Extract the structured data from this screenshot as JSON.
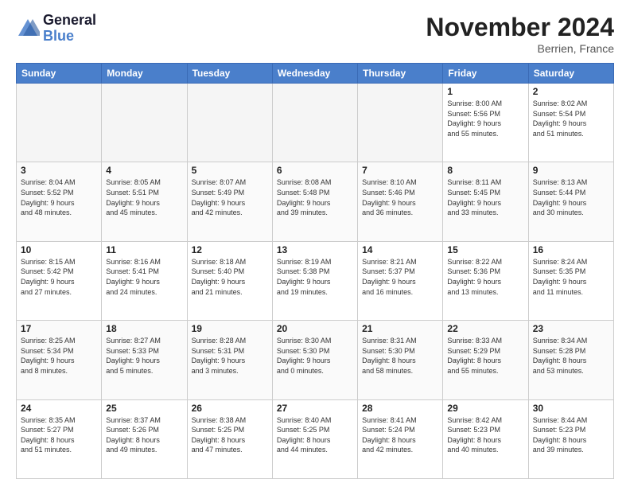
{
  "logo": {
    "line1": "General",
    "line2": "Blue"
  },
  "title": "November 2024",
  "location": "Berrien, France",
  "days_of_week": [
    "Sunday",
    "Monday",
    "Tuesday",
    "Wednesday",
    "Thursday",
    "Friday",
    "Saturday"
  ],
  "weeks": [
    [
      {
        "day": "",
        "info": ""
      },
      {
        "day": "",
        "info": ""
      },
      {
        "day": "",
        "info": ""
      },
      {
        "day": "",
        "info": ""
      },
      {
        "day": "",
        "info": ""
      },
      {
        "day": "1",
        "info": "Sunrise: 8:00 AM\nSunset: 5:56 PM\nDaylight: 9 hours\nand 55 minutes."
      },
      {
        "day": "2",
        "info": "Sunrise: 8:02 AM\nSunset: 5:54 PM\nDaylight: 9 hours\nand 51 minutes."
      }
    ],
    [
      {
        "day": "3",
        "info": "Sunrise: 8:04 AM\nSunset: 5:52 PM\nDaylight: 9 hours\nand 48 minutes."
      },
      {
        "day": "4",
        "info": "Sunrise: 8:05 AM\nSunset: 5:51 PM\nDaylight: 9 hours\nand 45 minutes."
      },
      {
        "day": "5",
        "info": "Sunrise: 8:07 AM\nSunset: 5:49 PM\nDaylight: 9 hours\nand 42 minutes."
      },
      {
        "day": "6",
        "info": "Sunrise: 8:08 AM\nSunset: 5:48 PM\nDaylight: 9 hours\nand 39 minutes."
      },
      {
        "day": "7",
        "info": "Sunrise: 8:10 AM\nSunset: 5:46 PM\nDaylight: 9 hours\nand 36 minutes."
      },
      {
        "day": "8",
        "info": "Sunrise: 8:11 AM\nSunset: 5:45 PM\nDaylight: 9 hours\nand 33 minutes."
      },
      {
        "day": "9",
        "info": "Sunrise: 8:13 AM\nSunset: 5:44 PM\nDaylight: 9 hours\nand 30 minutes."
      }
    ],
    [
      {
        "day": "10",
        "info": "Sunrise: 8:15 AM\nSunset: 5:42 PM\nDaylight: 9 hours\nand 27 minutes."
      },
      {
        "day": "11",
        "info": "Sunrise: 8:16 AM\nSunset: 5:41 PM\nDaylight: 9 hours\nand 24 minutes."
      },
      {
        "day": "12",
        "info": "Sunrise: 8:18 AM\nSunset: 5:40 PM\nDaylight: 9 hours\nand 21 minutes."
      },
      {
        "day": "13",
        "info": "Sunrise: 8:19 AM\nSunset: 5:38 PM\nDaylight: 9 hours\nand 19 minutes."
      },
      {
        "day": "14",
        "info": "Sunrise: 8:21 AM\nSunset: 5:37 PM\nDaylight: 9 hours\nand 16 minutes."
      },
      {
        "day": "15",
        "info": "Sunrise: 8:22 AM\nSunset: 5:36 PM\nDaylight: 9 hours\nand 13 minutes."
      },
      {
        "day": "16",
        "info": "Sunrise: 8:24 AM\nSunset: 5:35 PM\nDaylight: 9 hours\nand 11 minutes."
      }
    ],
    [
      {
        "day": "17",
        "info": "Sunrise: 8:25 AM\nSunset: 5:34 PM\nDaylight: 9 hours\nand 8 minutes."
      },
      {
        "day": "18",
        "info": "Sunrise: 8:27 AM\nSunset: 5:33 PM\nDaylight: 9 hours\nand 5 minutes."
      },
      {
        "day": "19",
        "info": "Sunrise: 8:28 AM\nSunset: 5:31 PM\nDaylight: 9 hours\nand 3 minutes."
      },
      {
        "day": "20",
        "info": "Sunrise: 8:30 AM\nSunset: 5:30 PM\nDaylight: 9 hours\nand 0 minutes."
      },
      {
        "day": "21",
        "info": "Sunrise: 8:31 AM\nSunset: 5:30 PM\nDaylight: 8 hours\nand 58 minutes."
      },
      {
        "day": "22",
        "info": "Sunrise: 8:33 AM\nSunset: 5:29 PM\nDaylight: 8 hours\nand 55 minutes."
      },
      {
        "day": "23",
        "info": "Sunrise: 8:34 AM\nSunset: 5:28 PM\nDaylight: 8 hours\nand 53 minutes."
      }
    ],
    [
      {
        "day": "24",
        "info": "Sunrise: 8:35 AM\nSunset: 5:27 PM\nDaylight: 8 hours\nand 51 minutes."
      },
      {
        "day": "25",
        "info": "Sunrise: 8:37 AM\nSunset: 5:26 PM\nDaylight: 8 hours\nand 49 minutes."
      },
      {
        "day": "26",
        "info": "Sunrise: 8:38 AM\nSunset: 5:25 PM\nDaylight: 8 hours\nand 47 minutes."
      },
      {
        "day": "27",
        "info": "Sunrise: 8:40 AM\nSunset: 5:25 PM\nDaylight: 8 hours\nand 44 minutes."
      },
      {
        "day": "28",
        "info": "Sunrise: 8:41 AM\nSunset: 5:24 PM\nDaylight: 8 hours\nand 42 minutes."
      },
      {
        "day": "29",
        "info": "Sunrise: 8:42 AM\nSunset: 5:23 PM\nDaylight: 8 hours\nand 40 minutes."
      },
      {
        "day": "30",
        "info": "Sunrise: 8:44 AM\nSunset: 5:23 PM\nDaylight: 8 hours\nand 39 minutes."
      }
    ]
  ]
}
